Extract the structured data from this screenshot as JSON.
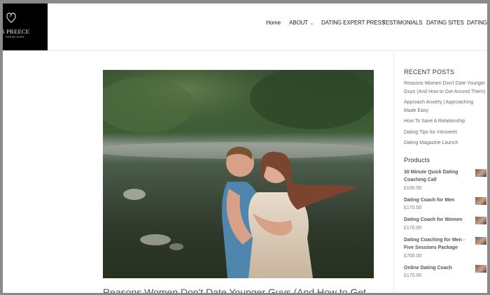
{
  "site": {
    "logo_name": "S PREECE",
    "logo_tagline": "DATING GURU"
  },
  "nav": {
    "items": [
      {
        "label": "Home"
      },
      {
        "label": "ABOUT",
        "dropdown": true
      },
      {
        "label": "DATING EXPERT PRESS"
      },
      {
        "label": "TESTIMONIALS"
      },
      {
        "label": "DATING SITES"
      },
      {
        "label": "DATING"
      }
    ],
    "dropdown_glyph": "⌄"
  },
  "post": {
    "title": "Reasons Women Don't Date Younger Guys (And How to Get"
  },
  "sidebar": {
    "recent_title": "RECENT POSTS",
    "recent_posts": [
      "Reasons Women Don't Date Younger Guys (And How to Get Around Them)",
      "Approach Anxiety | Approaching Made Easy",
      "How To Save A Relationship",
      "Dating Tips for Introverts",
      "Dating Magazine Launch"
    ],
    "products_title": "Products",
    "products": [
      {
        "name": "30 Minute Quick Dating Coaching Call",
        "price": "£100.00"
      },
      {
        "name": "Dating Coach for Men",
        "price": "£170.00"
      },
      {
        "name": "Dating Coach for Women",
        "price": "£170.00"
      },
      {
        "name": "Dating Coaching for Men - Five Sessions Package",
        "price": "£700.00"
      },
      {
        "name": "Online Dating Coach",
        "price": "£170.00"
      }
    ]
  },
  "colors": {
    "accent_text": "#1b1b1b",
    "muted_text": "#6b6b6b"
  }
}
